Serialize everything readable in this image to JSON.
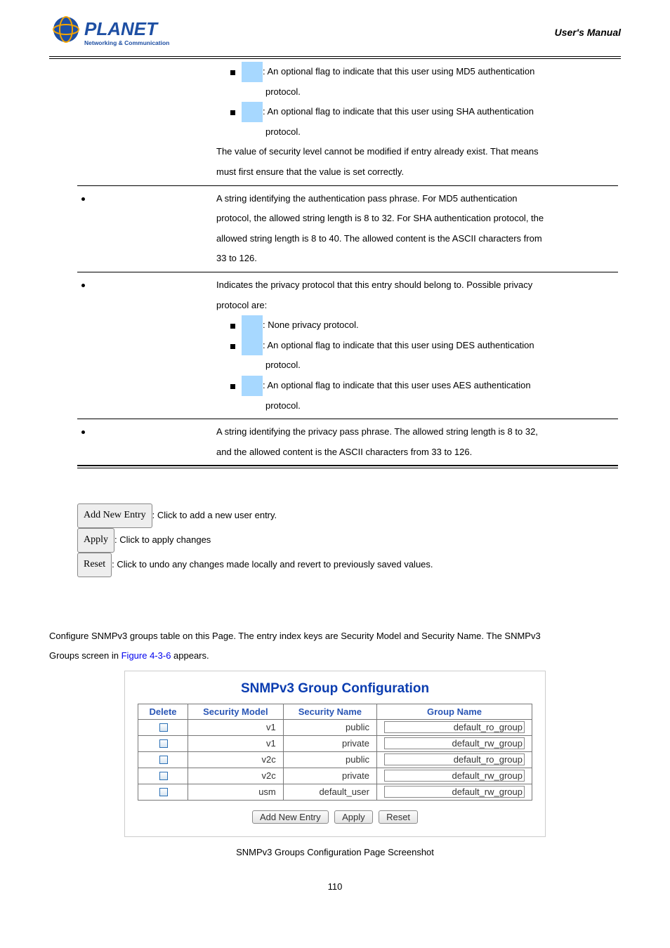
{
  "header": {
    "brand_top": "PLANET",
    "brand_sub": "Networking & Communication",
    "manual_title": "User's Manual"
  },
  "param_rows": [
    {
      "label_bullet": false,
      "label": "",
      "content_type": "auth_continued",
      "md5_text": ": An optional flag to indicate that this user using MD5 authentication",
      "md5_sub": "protocol.",
      "sha_text": ": An optional flag to indicate that this user using SHA authentication",
      "sha_sub": "protocol.",
      "tail1": "The value of security level cannot be modified if entry already exist. That means",
      "tail2": "must first ensure that the value is set correctly."
    },
    {
      "label_bullet": true,
      "label": "",
      "content_type": "authpw",
      "line1": "A string identifying the authentication pass phrase. For MD5 authentication",
      "line2": "protocol, the allowed string length is 8 to 32. For SHA authentication protocol, the",
      "line3": "allowed string length is 8 to 40. The allowed content is the ASCII characters from",
      "line4": "33 to 126."
    },
    {
      "label_bullet": true,
      "label": "",
      "content_type": "privproto",
      "intro1": "Indicates the privacy protocol that this entry should belong to. Possible privacy",
      "intro2": "protocol are:",
      "none_text": ": None privacy protocol.",
      "des_text": ": An optional flag to indicate that this user using DES authentication",
      "des_sub": "protocol.",
      "aes_text": ": An optional flag to indicate that this user uses AES authentication",
      "aes_sub": "protocol."
    },
    {
      "label_bullet": true,
      "label": "",
      "content_type": "privpw",
      "line1": "A string identifying the privacy pass phrase. The allowed string length is 8 to 32,",
      "line2": "and the allowed content is the ASCII characters from 33 to 126."
    }
  ],
  "buttons": {
    "add_label": "Add New Entry",
    "add_desc": ": Click to add a new user entry.",
    "apply_label": "Apply",
    "apply_desc": ": Click to apply changes",
    "reset_label": "Reset",
    "reset_desc": ": Click to undo any changes made locally and revert to previously saved values."
  },
  "section": {
    "intro1": "Configure SNMPv3 groups table on this Page. The entry index keys are Security Model and Security Name. The SNMPv3",
    "intro2_a": "Groups screen in ",
    "fig_link": "Figure 4-3-6",
    "intro2_b": " appears."
  },
  "screenshot": {
    "title": "SNMPv3 Group Configuration",
    "headers": {
      "del": "Delete",
      "sm": "Security Model",
      "sn": "Security Name",
      "gn": "Group Name"
    },
    "rows": [
      {
        "sm": "v1",
        "sn": "public",
        "gn": "default_ro_group"
      },
      {
        "sm": "v1",
        "sn": "private",
        "gn": "default_rw_group"
      },
      {
        "sm": "v2c",
        "sn": "public",
        "gn": "default_ro_group"
      },
      {
        "sm": "v2c",
        "sn": "private",
        "gn": "default_rw_group"
      },
      {
        "sm": "usm",
        "sn": "default_user",
        "gn": "default_rw_group"
      }
    ],
    "btns": {
      "add": "Add New Entry",
      "apply": "Apply",
      "reset": "Reset"
    }
  },
  "caption": "SNMPv3 Groups Configuration Page Screenshot",
  "page_number": "110"
}
